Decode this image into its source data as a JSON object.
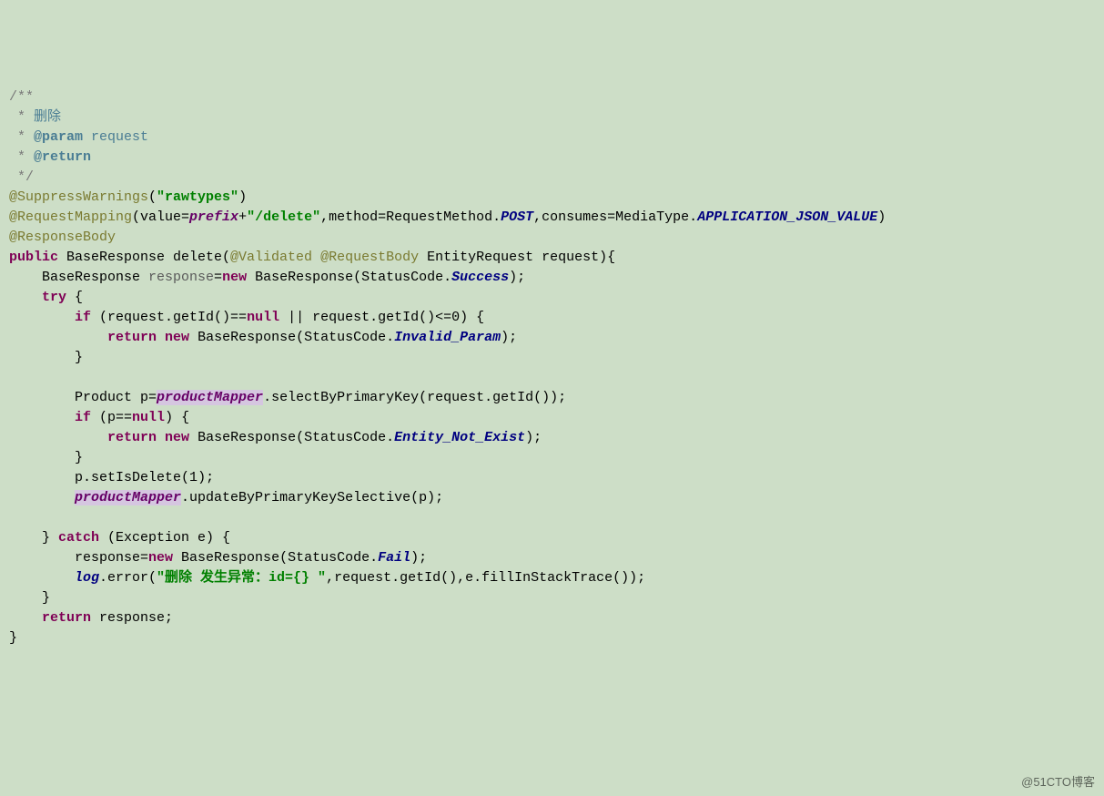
{
  "code": {
    "l01a": "/**",
    "l02a": " * ",
    "l02b": "删除",
    "l03a": " * ",
    "l03b": "@param",
    "l03c": " request",
    "l04a": " * ",
    "l04b": "@return",
    "l05a": " */",
    "l06a": "@SuppressWarnings",
    "l06b": "(",
    "l06c": "\"rawtypes\"",
    "l06d": ")",
    "l07a": "@RequestMapping",
    "l07b": "(value=",
    "l07c": "prefix",
    "l07d": "+",
    "l07e": "\"/delete\"",
    "l07f": ",method=RequestMethod.",
    "l07g": "POST",
    "l07h": ",consumes=MediaType.",
    "l07i": "APPLICATION_JSON_VALUE",
    "l07j": ")",
    "l08a": "@ResponseBody",
    "l09a": "public ",
    "l09b": "BaseResponse delete(",
    "l09c": "@Validated @RequestBody ",
    "l09d": "EntityRequest request){",
    "l10a": "    BaseResponse ",
    "l10b": "response",
    "l10c": "=",
    "l10d": "new ",
    "l10e": "BaseResponse(StatusCode.",
    "l10f": "Success",
    "l10g": ");",
    "l11a": "    ",
    "l11b": "try ",
    "l11c": "{",
    "l12a": "        ",
    "l12b": "if ",
    "l12c": "(request.getId()==",
    "l12d": "null ",
    "l12e": "|| request.getId()<=",
    "l12f": "0",
    "l12g": ") {",
    "l13a": "            ",
    "l13b": "return new ",
    "l13c": "BaseResponse(StatusCode.",
    "l13d": "Invalid_Param",
    "l13e": ");",
    "l14a": "        }",
    "l15a": "",
    "l16a": "        Product p=",
    "l16b": "productMapper",
    "l16c": ".selectByPrimaryKey(request.getId());",
    "l17a": "        ",
    "l17b": "if ",
    "l17c": "(p==",
    "l17d": "null",
    "l17e": ") {",
    "l18a": "            ",
    "l18b": "return new ",
    "l18c": "BaseResponse(StatusCode.",
    "l18d": "Entity_Not_Exist",
    "l18e": ");",
    "l19a": "        }",
    "l20a": "        p.setIsDelete(",
    "l20b": "1",
    "l20c": ");",
    "l21a": "        ",
    "l21b": "productMapper",
    "l21c": ".updateByPrimaryKeySelective(p);",
    "l22a": "",
    "l23a": "    } ",
    "l23b": "catch ",
    "l23c": "(Exception e) {",
    "l24a": "        response=",
    "l24b": "new ",
    "l24c": "BaseResponse(StatusCode.",
    "l24d": "Fail",
    "l24e": ");",
    "l25a": "        ",
    "l25b": "log",
    "l25c": ".error(",
    "l25d": "\"删除 发生异常：id={} \"",
    "l25e": ",request.getId(),e.fillInStackTrace());",
    "l26a": "    }",
    "l27a": "    ",
    "l27b": "return ",
    "l27c": "response;",
    "l28a": "}"
  },
  "watermark": "@51CTO博客"
}
